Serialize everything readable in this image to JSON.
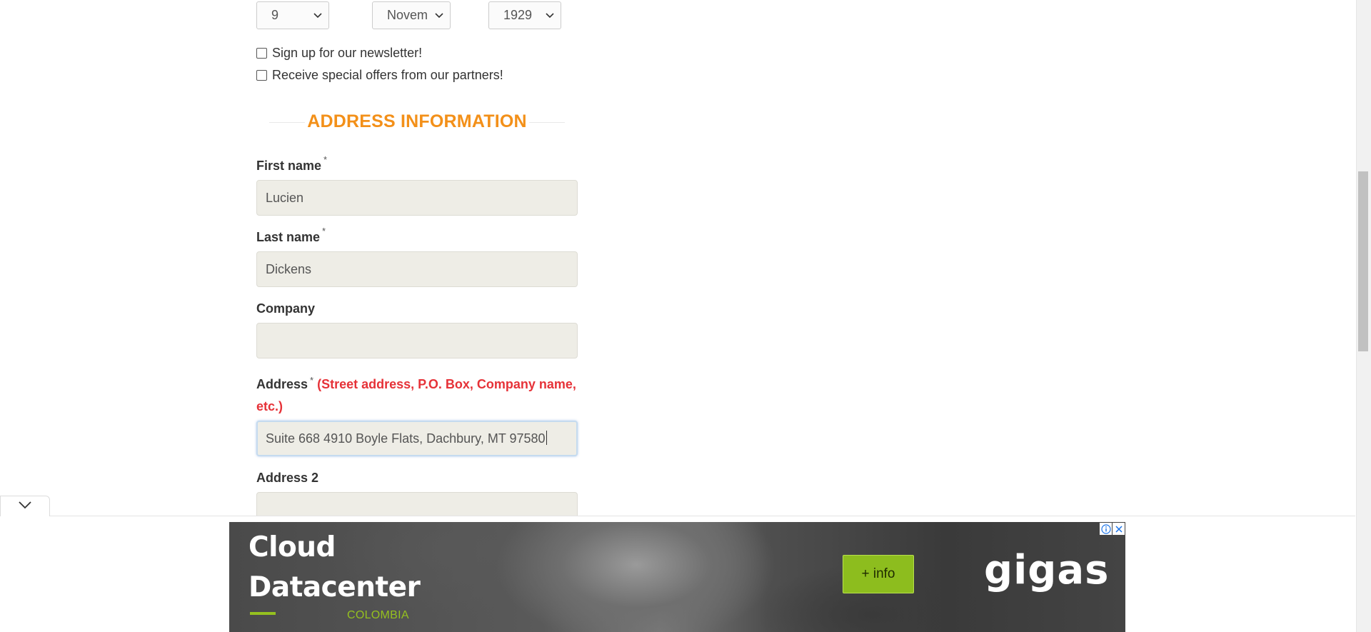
{
  "dob": {
    "day": "9",
    "month": "Novem",
    "year": "1929"
  },
  "checkboxes": {
    "newsletter": "Sign up for our newsletter!",
    "offers": "Receive special offers from our partners!"
  },
  "section": {
    "title": "ADDRESS INFORMATION"
  },
  "fields": {
    "first_name": {
      "label": "First name",
      "required": "*",
      "value": "Lucien"
    },
    "last_name": {
      "label": "Last name",
      "required": "*",
      "value": "Dickens"
    },
    "company": {
      "label": "Company",
      "value": ""
    },
    "address": {
      "label": "Address",
      "required": "*",
      "hint": "(Street address, P.O. Box, Company name, etc.)",
      "value": "Suite 668 4910 Boyle Flats, Dachbury, MT 97580"
    },
    "address2": {
      "label": "Address 2",
      "value": ""
    }
  },
  "ad": {
    "title": "Cloud\nDatacenter",
    "subtitle": "COLOMBIA",
    "button": "+ info",
    "brand": "gigas",
    "accent_color": "#95c11f",
    "icons": [
      "info-icon",
      "close-icon",
      "chevron-down-icon"
    ]
  },
  "colors": {
    "section_title": "#f39019",
    "hint": "#e63238",
    "input_bg": "#eeede6"
  }
}
